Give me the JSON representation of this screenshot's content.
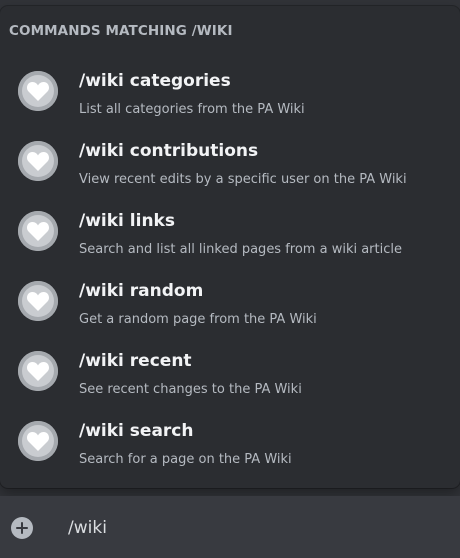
{
  "autocomplete": {
    "header": "COMMANDS MATCHING /WIKI",
    "commands": [
      {
        "name": "/wiki categories",
        "description": "List all categories from the PA Wiki",
        "icon": "heart-icon"
      },
      {
        "name": "/wiki contributions",
        "description": "View recent edits by a specific user on the PA Wiki",
        "icon": "heart-icon"
      },
      {
        "name": "/wiki links",
        "description": "Search and list all linked pages from a wiki article",
        "icon": "heart-icon"
      },
      {
        "name": "/wiki random",
        "description": "Get a random page from the PA Wiki",
        "icon": "heart-icon"
      },
      {
        "name": "/wiki recent",
        "description": "See recent changes to the PA Wiki",
        "icon": "heart-icon"
      },
      {
        "name": "/wiki search",
        "description": "Search for a page on the PA Wiki",
        "icon": "heart-icon"
      }
    ]
  },
  "composer": {
    "value": "/wiki",
    "add_icon": "plus-circle-icon"
  },
  "colors": {
    "background": "#313338",
    "popup": "#2b2d31",
    "input": "#383a40",
    "text_primary": "#f2f3f5",
    "text_secondary": "#b5bac1"
  }
}
